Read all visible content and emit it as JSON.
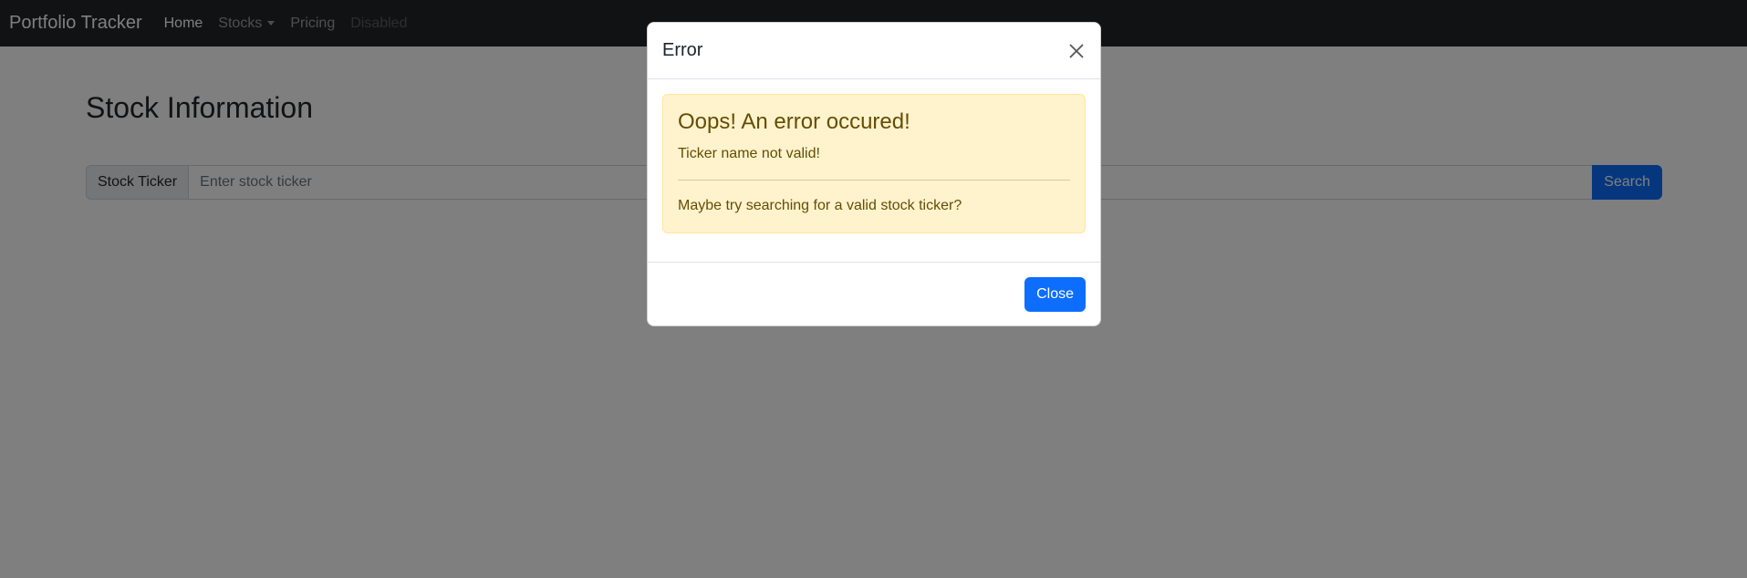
{
  "navbar": {
    "brand": "Portfolio Tracker",
    "links": [
      {
        "label": "Home",
        "state": "active"
      },
      {
        "label": "Stocks",
        "state": "dropdown"
      },
      {
        "label": "Pricing",
        "state": "normal"
      },
      {
        "label": "Disabled",
        "state": "disabled"
      }
    ]
  },
  "main": {
    "title": "Stock Information",
    "search": {
      "label": "Stock Ticker",
      "placeholder": "Enter stock ticker",
      "value": "",
      "button_label": "Search"
    }
  },
  "modal": {
    "title": "Error",
    "close_icon": "close-icon",
    "alert": {
      "heading": "Oops! An error occured!",
      "message": "Ticker name not valid!",
      "hint": "Maybe try searching for a valid stock ticker?"
    },
    "close_button_label": "Close"
  },
  "colors": {
    "navbar_bg": "#212529",
    "primary": "#0d6efd",
    "alert_bg": "#fff3cd",
    "alert_text": "#664d03"
  }
}
